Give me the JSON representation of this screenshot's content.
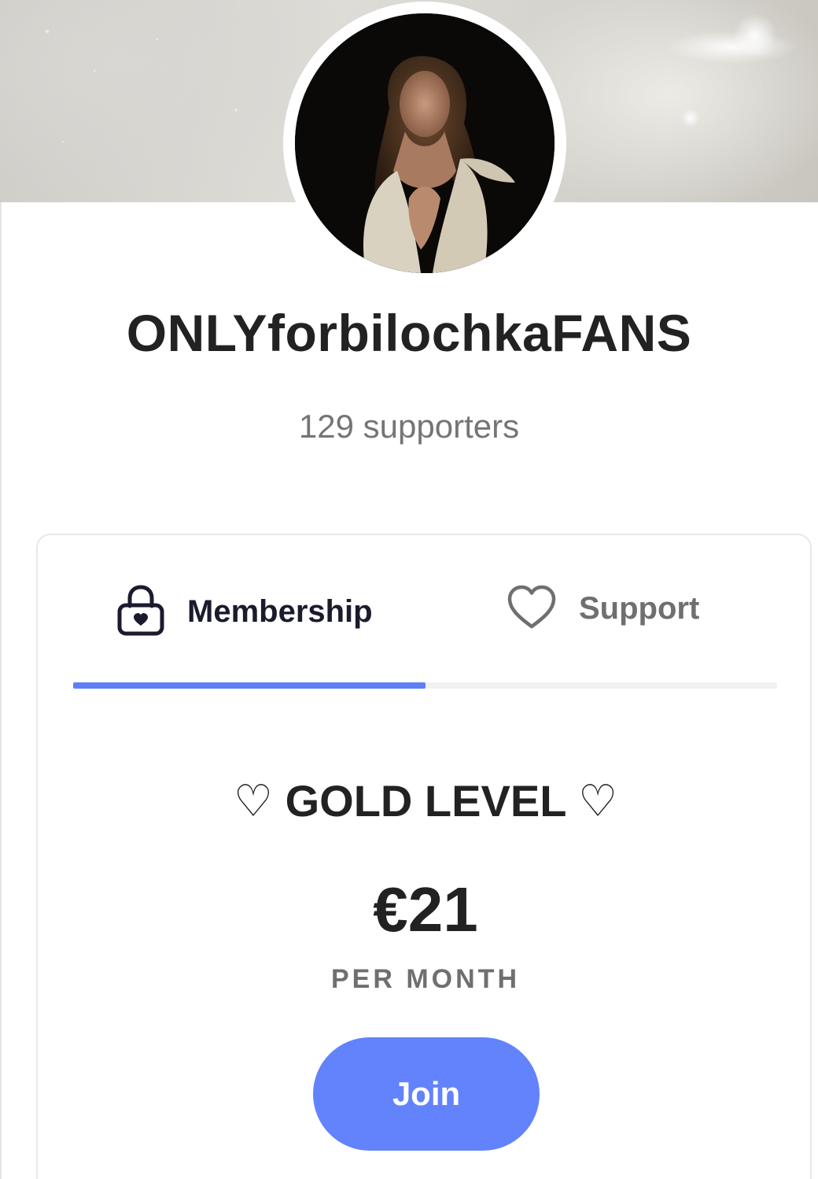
{
  "profile": {
    "name": "ONLYforbilochkaFANS",
    "supporters": "129 supporters"
  },
  "tabs": {
    "items": [
      {
        "label": "Membership",
        "icon": "lock-heart-icon",
        "active": true
      },
      {
        "label": "Support",
        "icon": "heart-outline-icon",
        "active": false
      }
    ],
    "active_color": "#5f7ff6"
  },
  "tier": {
    "name": "♡ GOLD LEVEL ♡",
    "price": "€21",
    "period": "PER MONTH",
    "join_label": "Join",
    "button_color": "#6283fb"
  }
}
